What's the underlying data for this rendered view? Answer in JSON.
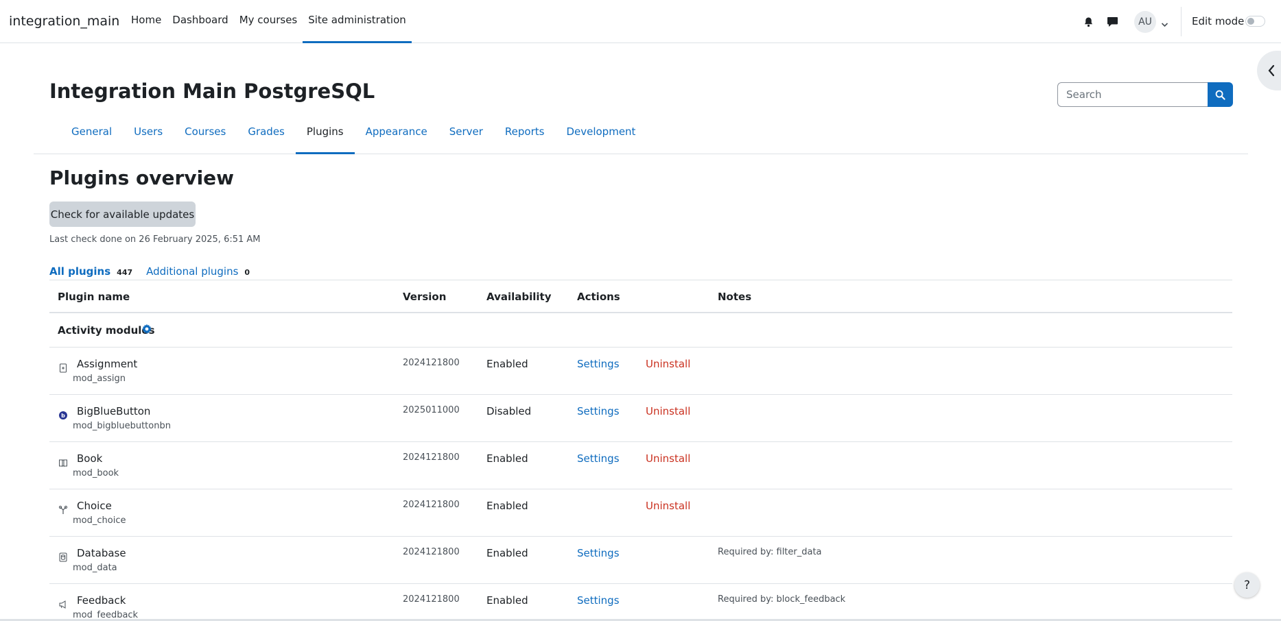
{
  "navbar": {
    "brand": "integration_main",
    "items": [
      {
        "label": "Home",
        "active": false
      },
      {
        "label": "Dashboard",
        "active": false
      },
      {
        "label": "My courses",
        "active": false
      },
      {
        "label": "Site administration",
        "active": true
      }
    ],
    "avatar_initials": "AU",
    "edit_mode_label": "Edit mode",
    "edit_mode_on": false
  },
  "header": {
    "site_title": "Integration Main PostgreSQL",
    "search_placeholder": "Search"
  },
  "secondary_nav": {
    "tabs": [
      {
        "label": "General",
        "active": false
      },
      {
        "label": "Users",
        "active": false
      },
      {
        "label": "Courses",
        "active": false
      },
      {
        "label": "Grades",
        "active": false
      },
      {
        "label": "Plugins",
        "active": true
      },
      {
        "label": "Appearance",
        "active": false
      },
      {
        "label": "Server",
        "active": false
      },
      {
        "label": "Reports",
        "active": false
      },
      {
        "label": "Development",
        "active": false
      }
    ]
  },
  "main": {
    "heading": "Plugins overview",
    "check_button": "Check for available updates",
    "last_check": "Last check done on 26 February 2025, 6:51 AM",
    "filters": [
      {
        "label": "All plugins",
        "count": "447",
        "active": true
      },
      {
        "label": "Additional plugins",
        "count": "0",
        "active": false
      }
    ]
  },
  "table": {
    "headers": {
      "name": "Plugin name",
      "version": "Version",
      "availability": "Availability",
      "actions": "Actions",
      "notes": "Notes"
    },
    "category": "Activity modules",
    "rows": [
      {
        "name": "Assignment",
        "component": "mod_assign",
        "version": "2024121800",
        "availability": "Enabled",
        "settings": "Settings",
        "uninstall": "Uninstall",
        "notes": "",
        "icon": "assignment-icon"
      },
      {
        "name": "BigBlueButton",
        "component": "mod_bigbluebuttonbn",
        "version": "2025011000",
        "availability": "Disabled",
        "settings": "Settings",
        "uninstall": "Uninstall",
        "notes": "",
        "icon": "bigbluebutton-icon"
      },
      {
        "name": "Book",
        "component": "mod_book",
        "version": "2024121800",
        "availability": "Enabled",
        "settings": "Settings",
        "uninstall": "Uninstall",
        "notes": "",
        "icon": "book-icon"
      },
      {
        "name": "Choice",
        "component": "mod_choice",
        "version": "2024121800",
        "availability": "Enabled",
        "settings": "",
        "uninstall": "Uninstall",
        "notes": "",
        "icon": "choice-icon"
      },
      {
        "name": "Database",
        "component": "mod_data",
        "version": "2024121800",
        "availability": "Enabled",
        "settings": "Settings",
        "uninstall": "",
        "notes": "Required by: filter_data",
        "icon": "database-icon"
      },
      {
        "name": "Feedback",
        "component": "mod_feedback",
        "version": "2024121800",
        "availability": "Enabled",
        "settings": "Settings",
        "uninstall": "",
        "notes": "Required by: block_feedback",
        "icon": "feedback-icon"
      }
    ]
  },
  "help_label": "?",
  "colors": {
    "primary": "#0f6cbf",
    "danger": "#ca3120",
    "text": "#1d2125",
    "muted": "#495057",
    "border": "#dee2e6"
  }
}
